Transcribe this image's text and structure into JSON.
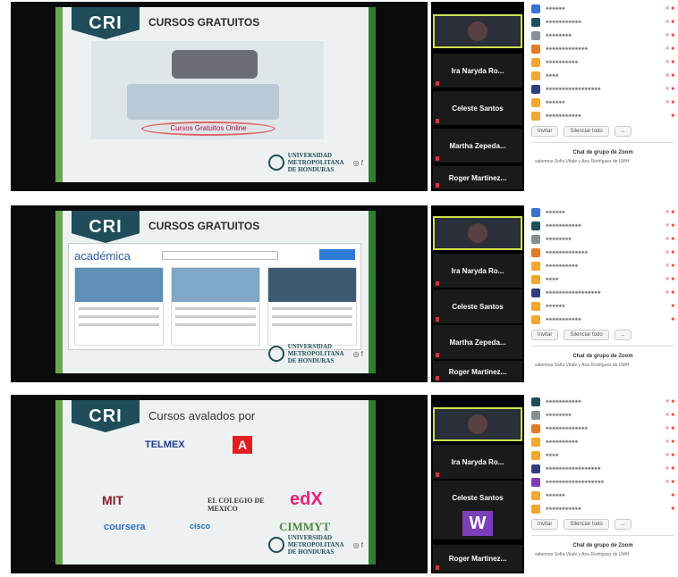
{
  "panels": [
    {
      "slide_title": "CURSOS GRATUITOS",
      "stage_caption": "Cursos Gratuitos Online",
      "participants_video": [
        "Ira Naryda Ro...",
        "Celeste Santos",
        "Martha Zepeda...",
        "Roger Martinez..."
      ]
    },
    {
      "slide_title": "CURSOS GRATUITOS",
      "academica_logo": "académica",
      "participants_video": [
        "Ira Naryda Ro...",
        "Celeste Santos",
        "Martha Zepeda...",
        "Roger Martinez..."
      ]
    },
    {
      "slide_title": "Cursos avalados por",
      "logos": [
        "TELMEX",
        "A",
        "MIT",
        "EL COLEGIO DE MEXICO",
        "edX",
        "coursera",
        "cisco",
        "CIMMYT"
      ],
      "participants_video": [
        "Ira Naryda Ro...",
        "Celeste Santos",
        "Roger Martinez..."
      ],
      "w_avatar": "W"
    }
  ],
  "common": {
    "brand": "CRI",
    "university": [
      "UNIVERSIDAD",
      "METROPOLITANA",
      "DE HONDURAS"
    ],
    "chat_title": "Chat de grupo de Zoom",
    "btn_invite": "Invitar",
    "btn_mute": "Silenciar todo",
    "btn_more": "...",
    "chat_message": "sabemos Sofía Vitale y Ana Rodríguez de UMH"
  },
  "colors": {
    "green": "#6aa84f",
    "teal": "#1f4d5a",
    "highlight": "#cfe14a",
    "mic_red": "#e03030",
    "purple": "#7b3fb8"
  }
}
